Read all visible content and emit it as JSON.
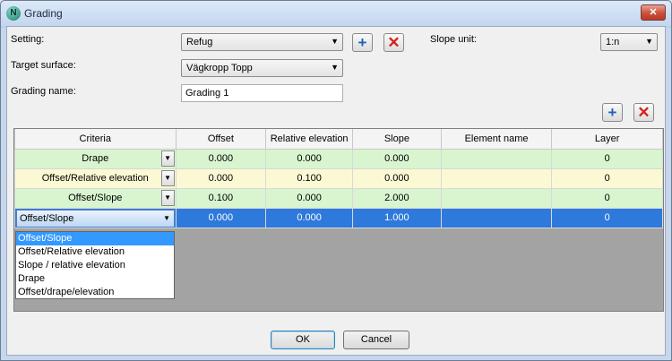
{
  "window": {
    "title": "Grading",
    "app_icon_letter": "N"
  },
  "form": {
    "setting_label": "Setting:",
    "setting_value": "Refug",
    "target_surface_label": "Target surface:",
    "target_surface_value": "Vägkropp Topp",
    "grading_name_label": "Grading name:",
    "grading_name_value": "Grading 1",
    "slope_unit_label": "Slope unit:",
    "slope_unit_value": "1:n"
  },
  "table": {
    "headers": [
      "Criteria",
      "Offset",
      "Relative elevation",
      "Slope",
      "Element name",
      "Layer"
    ],
    "rows": [
      {
        "criteria": "Drape",
        "offset": "0.000",
        "relative_elevation": "0.000",
        "slope": "0.000",
        "element_name": "",
        "layer": "0"
      },
      {
        "criteria": "Offset/Relative elevation",
        "offset": "0.000",
        "relative_elevation": "0.100",
        "slope": "0.000",
        "element_name": "",
        "layer": "0"
      },
      {
        "criteria": "Offset/Slope",
        "offset": "0.100",
        "relative_elevation": "0.000",
        "slope": "2.000",
        "element_name": "",
        "layer": "0"
      },
      {
        "criteria": "Offset/Slope",
        "offset": "0.000",
        "relative_elevation": "0.000",
        "slope": "1.000",
        "element_name": "",
        "layer": "0"
      }
    ]
  },
  "criteria_dropdown": {
    "options": [
      "Offset/Slope",
      "Offset/Relative elevation",
      "Slope / relative elevation",
      "Drape",
      "Offset/drape/elevation"
    ],
    "highlighted_index": 0
  },
  "buttons": {
    "ok": "OK",
    "cancel": "Cancel",
    "close_glyph": "✕"
  },
  "icons": {
    "add": "+",
    "delete": "✕",
    "dropdown_arrow": "▼"
  },
  "colors": {
    "row_green": "#d8f5d0",
    "row_yellow": "#fbf9d4",
    "row_selected": "#2e79dc",
    "delete_red": "#d2231b",
    "add_blue": "#1f62b8"
  }
}
